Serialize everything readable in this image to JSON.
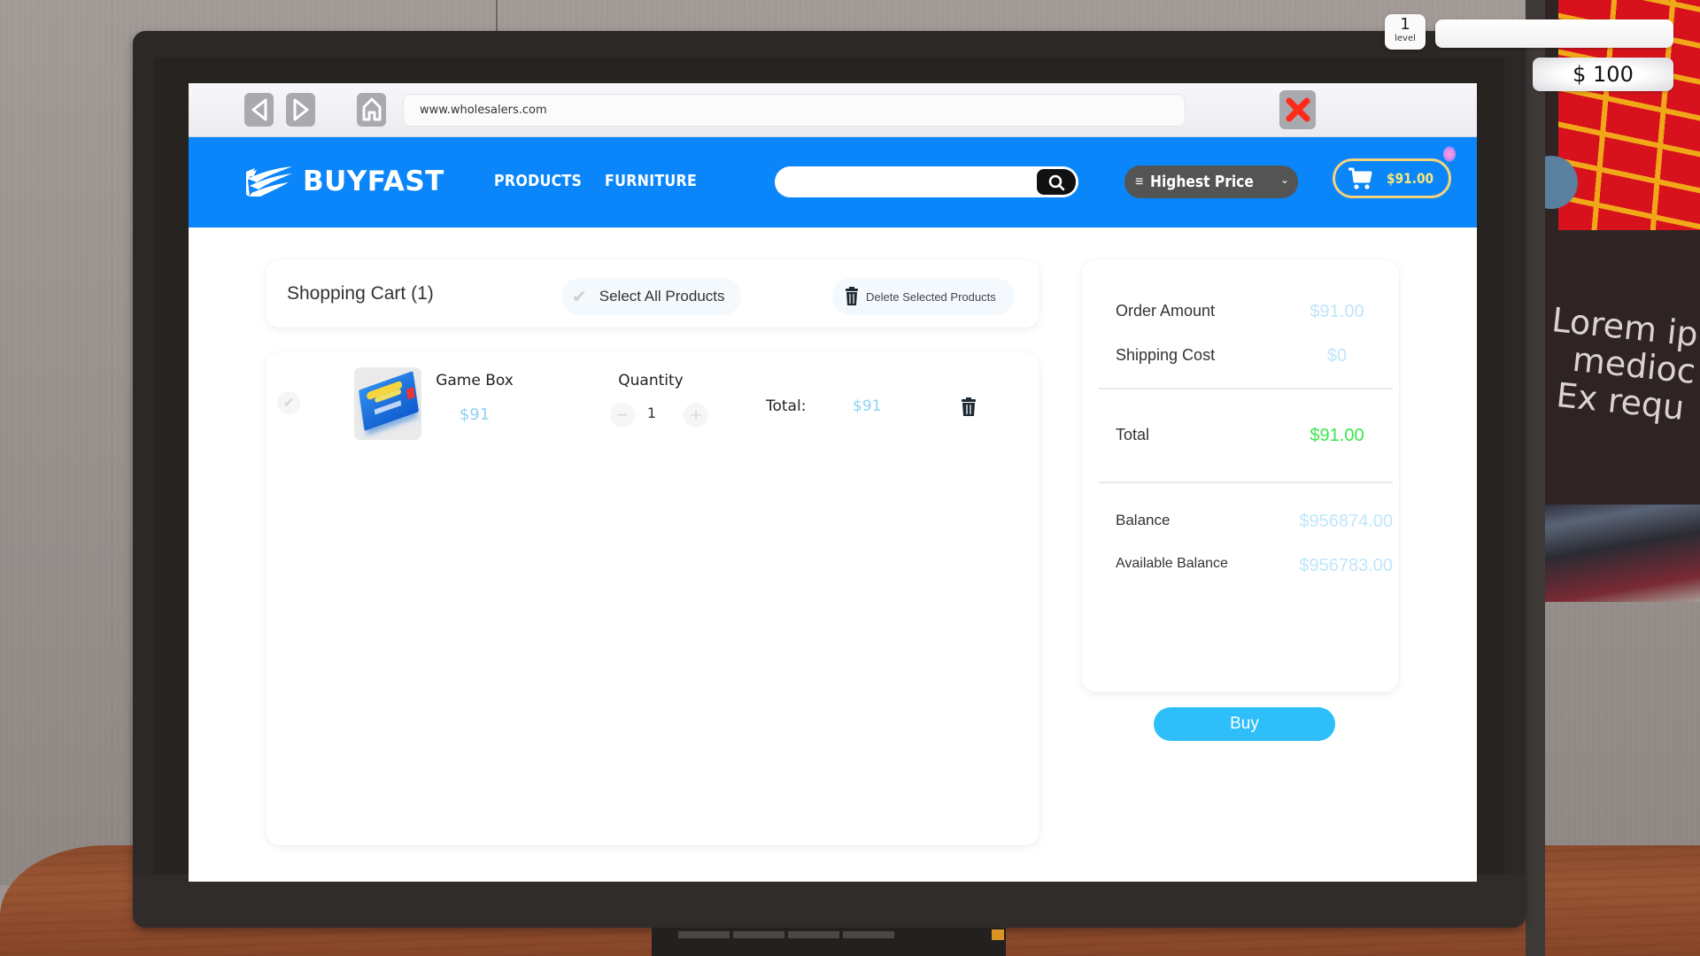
{
  "hud": {
    "level_value": "1",
    "level_label": "level",
    "xp_progress": 0,
    "money": "$ 100"
  },
  "background": {
    "poster_lines": [
      "Lorem ip",
      "medioc",
      "Ex requ"
    ]
  },
  "browser": {
    "url": "www.wholesalers.com",
    "back_icon": "back-arrow-icon",
    "forward_icon": "forward-arrow-icon",
    "home_icon": "home-icon",
    "close_icon": "close-x-icon",
    "close_color": "#ff2a1a"
  },
  "site": {
    "brand_color": "#0a86fa",
    "logo_text": "BUYFAST",
    "nav": [
      {
        "label": "PRODUCTS"
      },
      {
        "label": "FURNITURE"
      }
    ],
    "search": {
      "value": "",
      "placeholder": "",
      "icon": "search-icon"
    },
    "sort": {
      "selected": "Highest Price",
      "icon": "menu-lines-icon"
    },
    "cart": {
      "amount": "$91.00",
      "icon": "shopping-cart-icon"
    }
  },
  "cart": {
    "title": "Shopping Cart (1)",
    "select_all_label": "Select All Products",
    "delete_selected_label": "Delete Selected Products",
    "items": [
      {
        "name": "Game Box",
        "price": "$91",
        "quantity_label": "Quantity",
        "quantity": "1",
        "total_label": "Total:",
        "total": "$91",
        "selected": false
      }
    ]
  },
  "summary": {
    "order_amount_label": "Order Amount",
    "order_amount": "$91.00",
    "shipping_label": "Shipping Cost",
    "shipping": "$0",
    "total_label": "Total",
    "total": "$91.00",
    "balance_label": "Balance",
    "balance": "$956874.00",
    "available_label": "Available Balance",
    "available": "$956783.00",
    "buy_label": "Buy",
    "buy_color": "#2ebefa",
    "total_color": "#3be54b"
  }
}
